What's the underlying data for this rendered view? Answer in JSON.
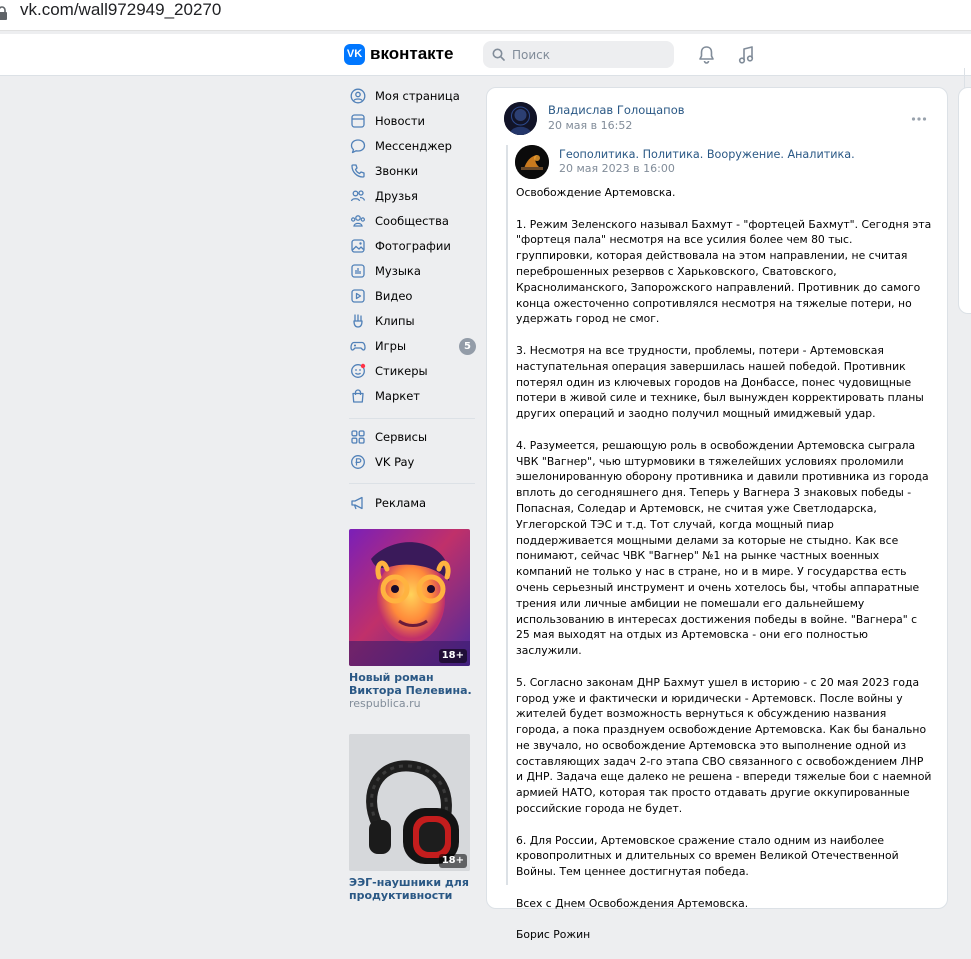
{
  "browser": {
    "url": "vk.com/wall972949_20270"
  },
  "header": {
    "logo_mark": "VK",
    "logo_text": "вконтакте",
    "search_placeholder": "Поиск"
  },
  "sidebar": {
    "items": [
      {
        "label": "Моя страница",
        "icon": "user-circle-icon"
      },
      {
        "label": "Новости",
        "icon": "newspaper-icon"
      },
      {
        "label": "Мессенджер",
        "icon": "message-bubble-icon"
      },
      {
        "label": "Звонки",
        "icon": "phone-icon"
      },
      {
        "label": "Друзья",
        "icon": "friends-icon"
      },
      {
        "label": "Сообщества",
        "icon": "communities-icon"
      },
      {
        "label": "Фотографии",
        "icon": "photo-icon"
      },
      {
        "label": "Музыка",
        "icon": "music-icon"
      },
      {
        "label": "Видео",
        "icon": "video-icon"
      },
      {
        "label": "Клипы",
        "icon": "clips-icon"
      },
      {
        "label": "Игры",
        "icon": "gamepad-icon",
        "badge": "5"
      },
      {
        "label": "Стикеры",
        "icon": "sticker-icon"
      },
      {
        "label": "Маркет",
        "icon": "bag-icon"
      }
    ],
    "items2": [
      {
        "label": "Сервисы",
        "icon": "grid-icon"
      },
      {
        "label": "VK Pay",
        "icon": "vkpay-icon"
      }
    ],
    "items3": [
      {
        "label": "Реклама",
        "icon": "megaphone-icon"
      }
    ],
    "ads": [
      {
        "title": "Новый роман Виктора Пелевина.",
        "domain": "respublica.ru",
        "age": "18+"
      },
      {
        "title": "ЭЭГ-наушники для продуктивности",
        "age": "18+"
      }
    ]
  },
  "post": {
    "author": "Владислав Голощапов",
    "date": "20 мая в 16:52",
    "repost": {
      "source": "Геополитика. Политика. Вооружение. Аналитика.",
      "date": "20 мая 2023 в 16:00"
    },
    "paragraphs": [
      "Освобождение Артемовска.",
      "1. Режим Зеленского называл Бахмут - \"фортецей Бахмут\". Сегодня эта \"фортеця пала\" несмотря на все усилия более чем 80 тыс. группировки, которая действовала на этом направлении, не считая переброшенных резервов с Харьковского, Сватовского, Краснолиманского, Запорожского направлений. Противник до самого конца ожесточенно сопротивлялся несмотря на тяжелые потери, но удержать город не смог.",
      "3. Несмотря на все трудности, проблемы, потери - Артемовская наступательная операция завершилась нашей победой. Противник потерял один из ключевых городов на Донбассе, понес чудовищные потери в живой силе и технике, был вынужден корректировать планы других операций и заодно получил мощный имиджевый удар.",
      "4. Разумеется, решающую роль в освобождении Артемовска сыграла ЧВК \"Вагнер\", чью штурмовики в тяжелейших условиях проломили эшелонированную оборону противника и давили противника из города вплоть до сегодняшнего дня. Теперь у Вагнера 3 знаковых победы - Попасная, Соледар и Артемовск, не считая уже Светлодарска, Углегорской ТЭС и т.д. Тот случай, когда мощный пиар поддерживается мощными делами за которые не стыдно. Как все понимают, сейчас ЧВК \"Вагнер\" №1 на рынке частных военных компаний не только у нас в стране, но и в мире. У государства есть очень серьезный инструмент и очень хотелось бы, чтобы аппаратные трения или личные амбиции не помешали его дальнейшему использованию в интересах достижения победы в войне. \"Вагнера\" с 25 мая выходят на отдых из Артемовска - они его полностью заслужили.",
      "5. Согласно законам ДНР Бахмут ушел в историю - с 20 мая 2023 года город уже и фактически и юридически - Артемовск. После войны у жителей будет возможность вернуться к обсуждению названия города, а пока празднуем освобождение Артемовска. Как бы банально не звучало, но освобождение Артемовска это выполнение одной из составляющих задач 2-го этапа СВО связанного с освобождением ЛНР и ДНР. Задача еще далеко не решена - впереди тяжелые бои с наемной армией НАТО, которая так просто отдавать другие оккупированные российские города не будет.",
      "6. Для России, Артемовское сражение стало одним из наиболее кровопролитных и длительных со времен Великой Отечественной Войны. Тем ценнее достигнутая победа.",
      "Всех с Днем Освобождения Артемовска.",
      "Борис Рожин"
    ]
  },
  "colors": {
    "accent": "#0077ff",
    "link": "#2a5885",
    "muted": "#818c99",
    "page_bg": "#edeef0"
  }
}
